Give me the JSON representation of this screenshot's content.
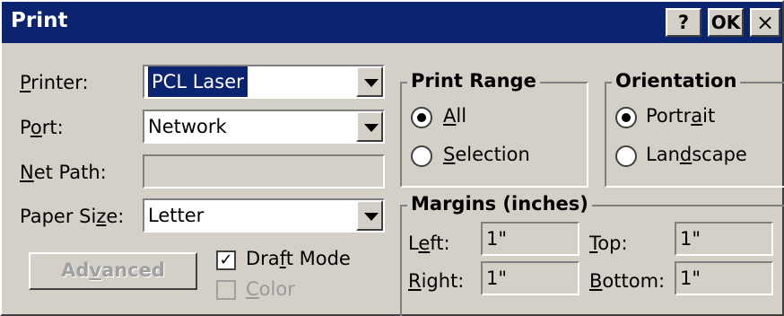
{
  "window": {
    "title": "Print"
  },
  "titlebar_buttons": {
    "help": "?",
    "ok": "OK",
    "close": "×"
  },
  "printer": {
    "label_pre": "",
    "label_ul": "P",
    "label_post": "rinter:",
    "value": "PCL Laser"
  },
  "port": {
    "label_pre": "P",
    "label_ul": "o",
    "label_post": "rt:",
    "value": "Network"
  },
  "net_path": {
    "label_pre": "",
    "label_ul": "N",
    "label_post": "et Path:",
    "value": ""
  },
  "paper_size": {
    "label_pre": "Paper Si",
    "label_ul": "z",
    "label_post": "e:",
    "value": "Letter"
  },
  "advanced": {
    "pre": "Ad",
    "ul": "v",
    "post": "anced"
  },
  "draft_mode": {
    "pre": "Dra",
    "ul": "f",
    "post": "t Mode",
    "checked": true
  },
  "color": {
    "pre": "",
    "ul": "C",
    "post": "olor",
    "checked": false
  },
  "print_range": {
    "title": "Print Range",
    "all": {
      "pre": "",
      "ul": "A",
      "post": "ll",
      "selected": true
    },
    "selection": {
      "pre": "",
      "ul": "S",
      "post": "election",
      "selected": false
    }
  },
  "orientation": {
    "title": "Orientation",
    "portrait": {
      "pre": "Portr",
      "ul": "a",
      "post": "it",
      "selected": true
    },
    "landscape": {
      "pre": "Lan",
      "ul": "d",
      "post": "scape",
      "selected": false
    }
  },
  "margins": {
    "title": "Margins (inches)",
    "left": {
      "pre": "L",
      "ul": "e",
      "post": "ft:",
      "value": "1\""
    },
    "top": {
      "pre": "",
      "ul": "T",
      "post": "op:",
      "value": "1\""
    },
    "right": {
      "pre": "",
      "ul": "R",
      "post": "ight:",
      "value": "1\""
    },
    "bottom": {
      "pre": "",
      "ul": "B",
      "post": "ottom:",
      "value": "1\""
    }
  },
  "colors": {
    "titlebar": "#0a2470",
    "face": "#d4d0c8"
  }
}
